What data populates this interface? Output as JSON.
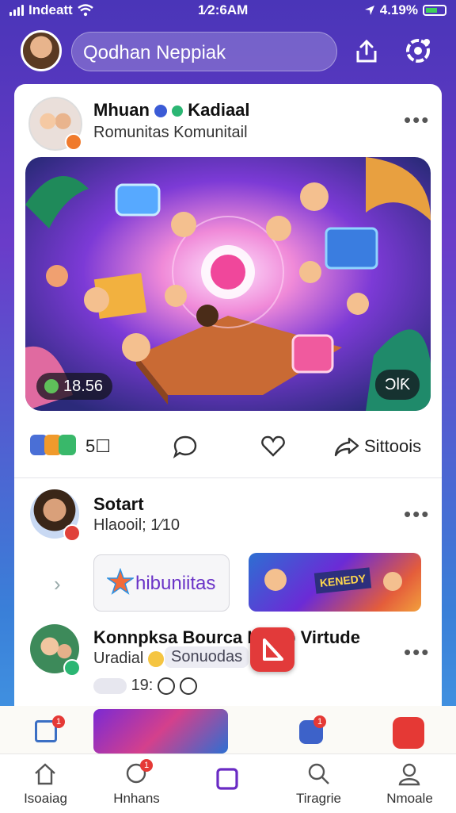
{
  "status": {
    "carrier": "Indeatt",
    "time": "1⁄2:6AM",
    "battery": "4.19%"
  },
  "header": {
    "search_text": "Qodhan Neppiak"
  },
  "post1": {
    "author": "Mhuan",
    "author2": "Kadiaal",
    "subtitle": "Romunitas Komunitail",
    "more": "•••",
    "image_chip_left": "18.56",
    "image_chip_right": "ƆƖƘ",
    "react_count": "5☐",
    "share_label": "Sittoois"
  },
  "post2": {
    "author": "Sotart",
    "subtitle": "Hlaooil; 1⁄10",
    "more": "•••",
    "pill_text": "hibuniitas",
    "banner_text": "KENEDY",
    "chevron": "›"
  },
  "post3": {
    "title": "Konnpksa Bourca Ks  db Virtude",
    "subtitle": "Uradial",
    "tag": "Sonuodas",
    "more": "•••",
    "meta_count": "19:"
  },
  "quickbar": {
    "badge1": "1",
    "badge2": "1"
  },
  "tabbar": {
    "tabs": [
      {
        "label": "Isoaiag",
        "badge": ""
      },
      {
        "label": "Hnhans",
        "badge": "1"
      },
      {
        "label": "",
        "badge": ""
      },
      {
        "label": "Tiragrie",
        "badge": ""
      },
      {
        "label": "Nmoale",
        "badge": ""
      }
    ]
  }
}
